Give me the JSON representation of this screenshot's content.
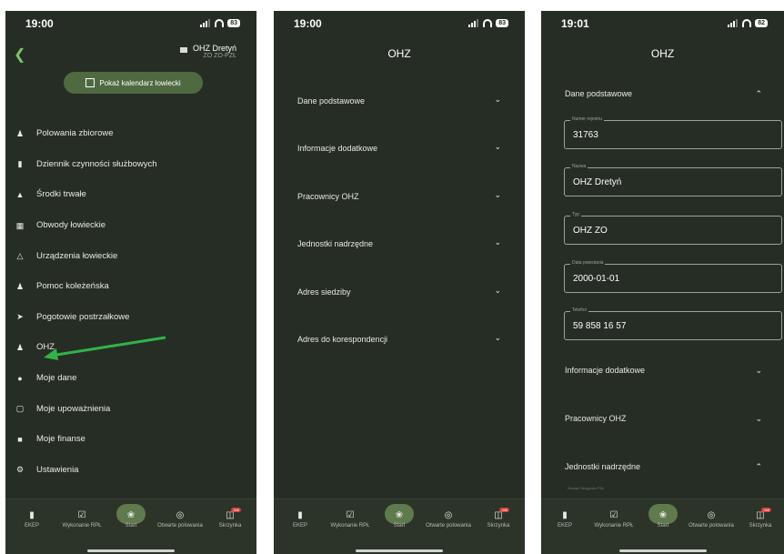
{
  "screens": [
    {
      "time": "19:00",
      "battery": "83",
      "header": {
        "org_name": "OHZ Dretyń",
        "org_code": "ZO ZO-PZŁ"
      },
      "calendar_button": "Pokaż kalendarz łowiecki",
      "menu": [
        {
          "label": "Polowania zbiorowe",
          "icon": "group-icon"
        },
        {
          "label": "Dziennik czynności służbowych",
          "icon": "journal-icon"
        },
        {
          "label": "Środki trwałe",
          "icon": "house-icon"
        },
        {
          "label": "Obwody łowieckie",
          "icon": "map-icon"
        },
        {
          "label": "Urządzenia łowieckie",
          "icon": "tower-icon"
        },
        {
          "label": "Pomoc koleżeńska",
          "icon": "group-icon"
        },
        {
          "label": "Pogotowie postrzałkowe",
          "icon": "dog-icon"
        },
        {
          "label": "OHZ",
          "icon": "group-icon"
        },
        {
          "label": "Moje dane",
          "icon": "person-icon"
        },
        {
          "label": "Moje upoważnienia",
          "icon": "document-icon"
        },
        {
          "label": "Moje finanse",
          "icon": "wallet-icon"
        },
        {
          "label": "Ustawienia",
          "icon": "gear-icon"
        }
      ]
    },
    {
      "time": "19:00",
      "battery": "83",
      "title": "OHZ",
      "sections": [
        "Dane podstawowe",
        "Informacje dodatkowe",
        "Pracownicy OHZ",
        "Jednostki nadrzędne",
        "Adres siedziby",
        "Adres do korespondencji"
      ]
    },
    {
      "time": "19:01",
      "battery": "82",
      "title": "OHZ",
      "open_section": "Dane podstawowe",
      "fields": [
        {
          "label": "Numer rejestru",
          "value": "31763"
        },
        {
          "label": "Nazwa",
          "value": "OHZ Dretyń"
        },
        {
          "label": "Typ",
          "value": "OHZ ZO"
        },
        {
          "label": "Data powstania",
          "value": "2000-01-01"
        },
        {
          "label": "Telefon",
          "value": "59 858 16 57"
        }
      ],
      "other_sections": [
        "Informacje dodatkowe",
        "Pracownicy OHZ",
        "Jednostki nadrzędne"
      ],
      "sub_caption": "Zarząd Okręgowy PZŁ"
    }
  ],
  "tabbar": [
    {
      "label": "EKEP",
      "icon": "book-icon"
    },
    {
      "label": "Wykonanie RPŁ",
      "icon": "calendar-check-icon"
    },
    {
      "label": "Start",
      "icon": "deer-icon"
    },
    {
      "label": "Otwarte polowania",
      "icon": "target-icon"
    },
    {
      "label": "Skrzynka",
      "icon": "inbox-icon",
      "badge": "288"
    }
  ],
  "colors": {
    "background": "#262d24",
    "accent": "#7ec466",
    "button": "#4f6a41",
    "arrow": "#2fb34a",
    "badge": "#d23b2f"
  }
}
